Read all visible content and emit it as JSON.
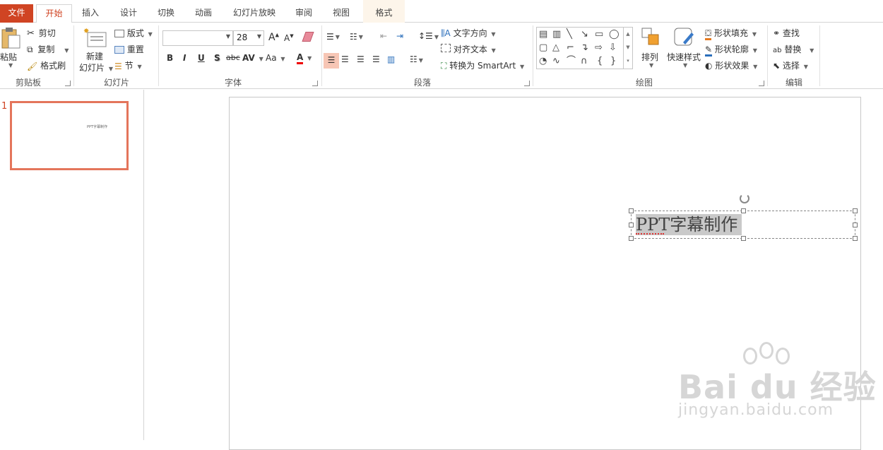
{
  "tabs": {
    "file": "文件",
    "home": "开始",
    "insert": "插入",
    "design": "设计",
    "transitions": "切换",
    "animations": "动画",
    "slideshow": "幻灯片放映",
    "review": "审阅",
    "view": "视图",
    "format": "格式"
  },
  "clipboard": {
    "paste": "粘贴",
    "cut": "剪切",
    "copy": "复制",
    "format_painter": "格式刷",
    "label": "剪贴板"
  },
  "slides": {
    "new_slide_1": "新建",
    "new_slide_2": "幻灯片",
    "layout": "版式",
    "reset": "重置",
    "section": "节",
    "label": "幻灯片"
  },
  "font": {
    "font_name": "",
    "font_size": "28",
    "grow": "A",
    "shrink": "A",
    "bold": "B",
    "italic": "I",
    "underline": "U",
    "shadow": "S",
    "strike": "abc",
    "spacing": "AV",
    "case": "Aa",
    "color": "A",
    "label": "字体"
  },
  "paragraph": {
    "text_direction": "文字方向",
    "align_text": "对齐文本",
    "smartart": "转换为 SmartArt",
    "label": "段落"
  },
  "drawing": {
    "arrange": "排列",
    "quick_styles": "快速样式",
    "shape_fill": "形状填充",
    "shape_outline": "形状轮廓",
    "shape_effects": "形状效果",
    "label": "绘图"
  },
  "editing": {
    "find": "查找",
    "replace": "替换",
    "select": "选择",
    "label": "编辑"
  },
  "thumbnail": {
    "number": "1",
    "text": "PPT字幕制作"
  },
  "slide": {
    "textbox_text": "PPT字幕制作"
  },
  "watermark": {
    "brand": "Bai du 经验",
    "url": "jingyan.baidu.com"
  },
  "colors": {
    "accent": "#d04423",
    "thumb_border": "#e4755b",
    "align_selected": "#f7c6b5"
  }
}
